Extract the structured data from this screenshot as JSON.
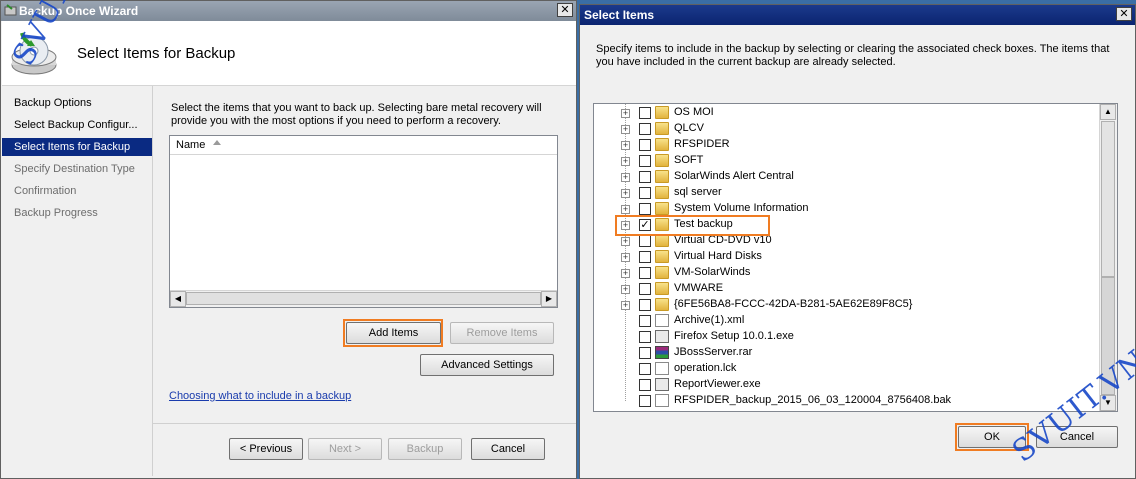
{
  "wizard": {
    "title": "Backup Once Wizard",
    "close": "✕",
    "header_title": "Select Items for Backup",
    "nav": [
      {
        "label": "Backup Options",
        "state": "done"
      },
      {
        "label": "Select Backup Configur...",
        "state": "done"
      },
      {
        "label": "Select Items for Backup",
        "state": "selected"
      },
      {
        "label": "Specify Destination Type",
        "state": "dim"
      },
      {
        "label": "Confirmation",
        "state": "dim"
      },
      {
        "label": "Backup Progress",
        "state": "dim"
      }
    ],
    "description": "Select the items that you want to back up. Selecting bare metal recovery will provide you with the most options if you need to perform a recovery.",
    "list_column": "Name",
    "add_items": "Add Items",
    "remove_items": "Remove Items",
    "advanced_settings": "Advanced Settings",
    "help_link": "Choosing what to include in a backup",
    "previous": "< Previous",
    "next": "Next >",
    "backup": "Backup",
    "cancel": "Cancel"
  },
  "dialog": {
    "title": "Select Items",
    "close": "✕",
    "description": "Specify items to include in the backup by selecting or clearing the associated check boxes. The items that you have included in the current backup are already selected.",
    "items": [
      {
        "label": "OS MOI",
        "type": "folder",
        "expandable": true,
        "checked": false
      },
      {
        "label": "QLCV",
        "type": "folder",
        "expandable": true,
        "checked": false
      },
      {
        "label": "RFSPIDER",
        "type": "folder",
        "expandable": true,
        "checked": false
      },
      {
        "label": "SOFT",
        "type": "folder",
        "expandable": true,
        "checked": false
      },
      {
        "label": "SolarWinds Alert Central",
        "type": "folder",
        "expandable": true,
        "checked": false
      },
      {
        "label": "sql server",
        "type": "folder",
        "expandable": true,
        "checked": false
      },
      {
        "label": "System Volume Information",
        "type": "folder",
        "expandable": true,
        "checked": false
      },
      {
        "label": "Test backup",
        "type": "folder",
        "expandable": true,
        "checked": true
      },
      {
        "label": "Virtual CD-DVD v10",
        "type": "folder",
        "expandable": true,
        "checked": false
      },
      {
        "label": "Virtual Hard Disks",
        "type": "folder",
        "expandable": true,
        "checked": false
      },
      {
        "label": "VM-SolarWinds",
        "type": "folder",
        "expandable": true,
        "checked": false
      },
      {
        "label": "VMWARE",
        "type": "folder",
        "expandable": true,
        "checked": false
      },
      {
        "label": "{6FE56BA8-FCCC-42DA-B281-5AE62E89F8C5}",
        "type": "folder",
        "expandable": true,
        "checked": false
      },
      {
        "label": "Archive(1).xml",
        "type": "file",
        "expandable": false,
        "checked": false
      },
      {
        "label": "Firefox Setup 10.0.1.exe",
        "type": "exe",
        "expandable": false,
        "checked": false
      },
      {
        "label": "JBossServer.rar",
        "type": "rar",
        "expandable": false,
        "checked": false
      },
      {
        "label": "operation.lck",
        "type": "file",
        "expandable": false,
        "checked": false
      },
      {
        "label": "ReportViewer.exe",
        "type": "exe",
        "expandable": false,
        "checked": false
      },
      {
        "label": "RFSPIDER_backup_2015_06_03_120004_8756408.bak",
        "type": "file",
        "expandable": false,
        "checked": false
      }
    ],
    "ok": "OK",
    "cancel": "Cancel"
  },
  "watermark": "SVUIT.VN",
  "colors": {
    "highlight": "#f07c22",
    "selection": "#0a2a82",
    "watermark": "#1848c8"
  }
}
